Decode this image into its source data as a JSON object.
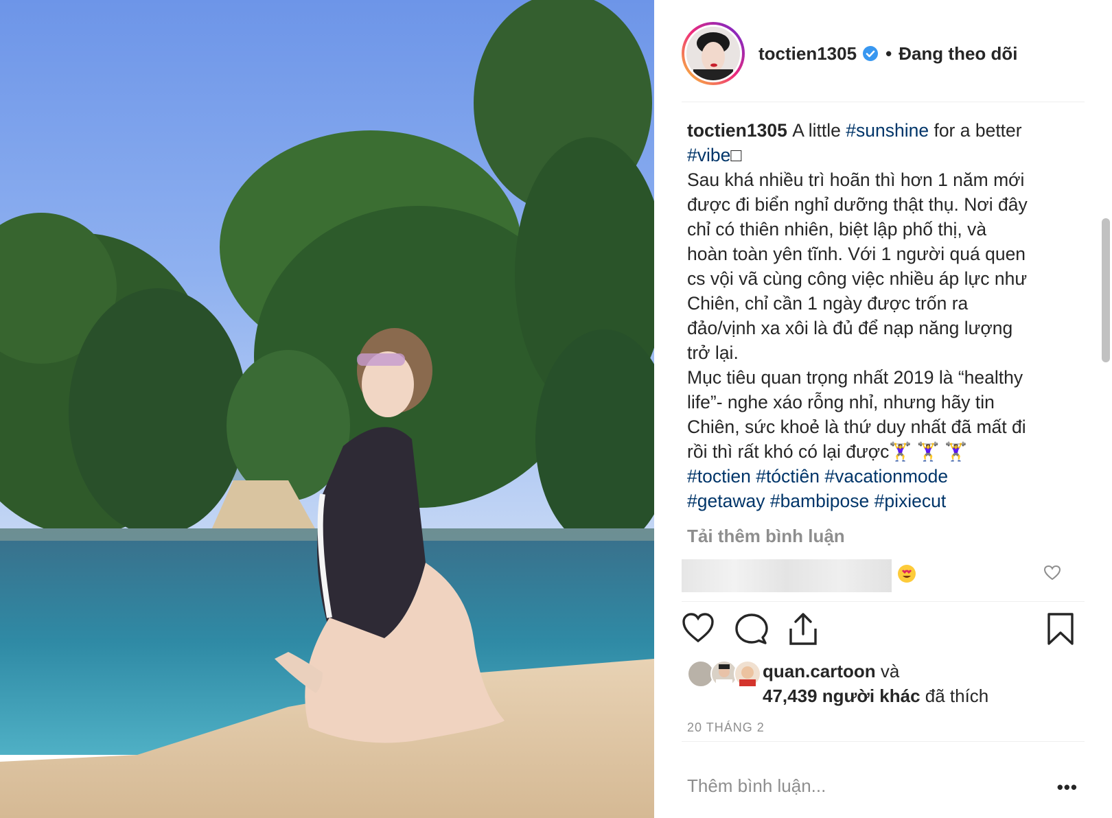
{
  "post": {
    "username": "toctien1305",
    "follow_label": "Đang theo dõi",
    "separator": "•"
  },
  "caption": {
    "username": "toctien1305",
    "lines": [
      {
        "parts": [
          {
            "t": "A little "
          },
          {
            "t": "#sunshine",
            "tag": true
          },
          {
            "t": " for a better"
          }
        ]
      },
      {
        "parts": [
          {
            "t": "#vibe",
            "tag": true
          },
          {
            "t": "□"
          }
        ]
      },
      {
        "parts": [
          {
            "t": "Sau khá nhiều trì hoãn thì hơn 1 năm mới"
          }
        ]
      },
      {
        "parts": [
          {
            "t": "được đi biển nghỉ dưỡng thật thụ. Nơi đây"
          }
        ]
      },
      {
        "parts": [
          {
            "t": "chỉ có thiên nhiên, biệt lập phố thị, và"
          }
        ]
      },
      {
        "parts": [
          {
            "t": "hoàn toàn yên tĩnh. Với 1 người quá quen"
          }
        ]
      },
      {
        "parts": [
          {
            "t": "cs vội vã cùng công việc nhiều áp lực như"
          }
        ]
      },
      {
        "parts": [
          {
            "t": "Chiên, chỉ cần 1 ngày được trốn ra"
          }
        ]
      },
      {
        "parts": [
          {
            "t": "đảo/vịnh xa xôi là đủ để nạp năng lượng"
          }
        ]
      },
      {
        "parts": [
          {
            "t": "trở lại."
          }
        ]
      },
      {
        "parts": [
          {
            "t": "Mục tiêu quan trọng nhất 2019 là “healthy"
          }
        ]
      },
      {
        "parts": [
          {
            "t": "life”- nghe xáo rỗng nhỉ, nhưng hãy tin"
          }
        ]
      },
      {
        "parts": [
          {
            "t": "Chiên, sức khoẻ là thứ duy nhất đã mất đi"
          }
        ]
      },
      {
        "parts": [
          {
            "t": "rồi thì rất khó có lại được🏋️‍♀️ 🏋️‍♀️ 🏋️‍♀️"
          }
        ]
      },
      {
        "parts": [
          {
            "t": "#toctien",
            "tag": true
          },
          {
            "t": " "
          },
          {
            "t": "#tóctiên",
            "tag": true
          },
          {
            "t": " "
          },
          {
            "t": "#vacationmode",
            "tag": true
          }
        ]
      },
      {
        "parts": [
          {
            "t": "#getaway",
            "tag": true
          },
          {
            "t": " "
          },
          {
            "t": "#bambipose",
            "tag": true
          },
          {
            "t": " "
          },
          {
            "t": "#pixiecut",
            "tag": true
          }
        ]
      }
    ]
  },
  "comments": {
    "load_more": "Tải thêm bình luận"
  },
  "likes": {
    "first_liker": "quan.cartoon",
    "and": " và",
    "count": "47,439 người khác",
    "suffix": " đã thích"
  },
  "date": "20 THÁNG 2",
  "comment_box": {
    "placeholder": "Thêm bình luận...",
    "more": "•••"
  },
  "colors": {
    "tag": "#003569",
    "verified": "#3897f0",
    "secondary": "#8e8e8e"
  }
}
